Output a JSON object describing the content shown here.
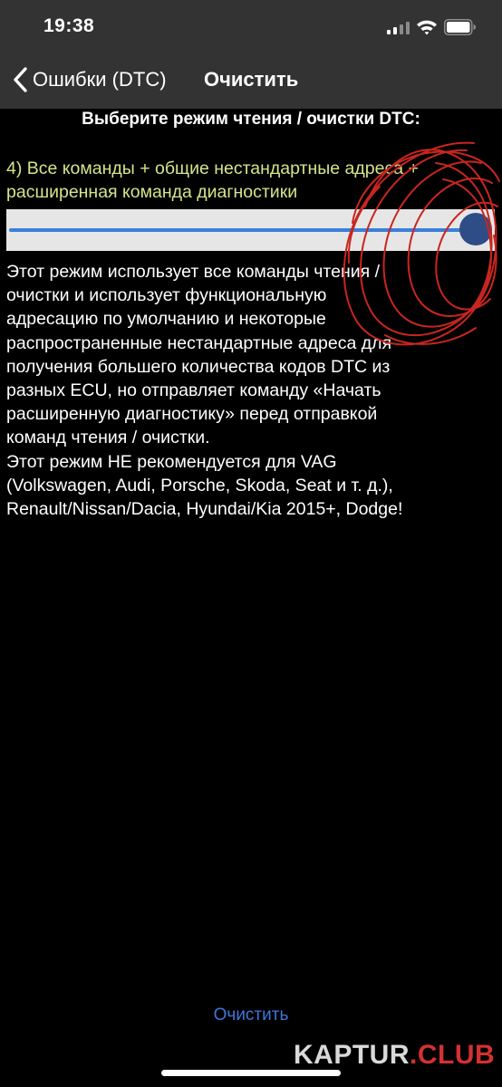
{
  "status_bar": {
    "time": "19:38",
    "icons": [
      "cellular-signal-icon",
      "wifi-icon",
      "battery-icon"
    ]
  },
  "nav": {
    "back_icon": "chevron-left-icon",
    "back_label": "Ошибки (DTC)",
    "title": "Очистить"
  },
  "content": {
    "heading": "Выберите режим чтения / очистки DTC:",
    "mode_label": "4) Все команды + общие нестандартные адреса + расширенная команда диагностики",
    "slider_value_fraction": 1.0,
    "description_lines": [
      "Этот режим использует все команды чтения /",
      "очистки и использует функциональную",
      "адресацию по умолчанию и некоторые",
      "распространенные нестандартные адреса для",
      "получения большего количества кодов DTC из",
      "разных ECU, но отправляет команду «Начать",
      "расширенную диагностику» перед отправкой",
      "команд чтения / очистки.",
      "Этот режим НЕ рекомендуется для VAG",
      "(Volkswagen, Audi, Porsche, Skoda, Seat и т. д.),",
      "Renault/Nissan/Dacia, Hyundai/Kia 2015+, Dodge!"
    ]
  },
  "actions": {
    "clear_label": "Очистить"
  },
  "watermark": {
    "part1": "KAPTUR",
    "part2": ".CLUB"
  },
  "colors": {
    "nav_background": "#333333",
    "mode_label": "#d7e38a",
    "accent_blue": "#3f76d8",
    "slider_thumb": "#2e4d87",
    "annotation_red": "#c8261f"
  }
}
